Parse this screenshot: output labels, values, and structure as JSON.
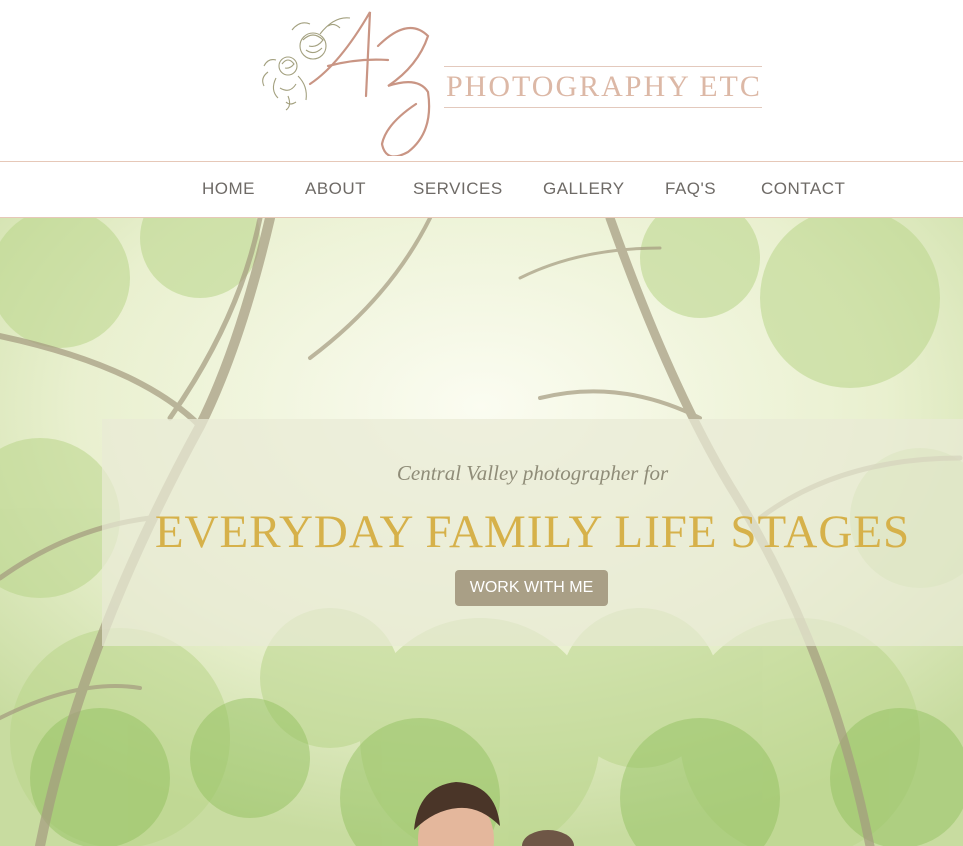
{
  "header": {
    "logo_monogram": "AZ",
    "logo_wordmark": "PHOTOGRAPHY ETC"
  },
  "nav": {
    "items": [
      {
        "label": "HOME"
      },
      {
        "label": "ABOUT"
      },
      {
        "label": "SERVICES"
      },
      {
        "label": "GALLERY"
      },
      {
        "label": "FAQ'S"
      },
      {
        "label": "CONTACT"
      }
    ]
  },
  "hero": {
    "subtitle": "Central Valley photographer for",
    "title": "EVERYDAY FAMILY LIFE STAGES",
    "cta_label": "WORK WITH ME"
  },
  "colors": {
    "logo_rose": "#c99584",
    "logo_sage": "#a3a07f",
    "nav_text": "#6e6a66",
    "nav_border": "#e6c8b8",
    "title_gold": "#d6b14a",
    "subtitle_olive": "#8f8c78",
    "button_bg": "#a99f86"
  }
}
